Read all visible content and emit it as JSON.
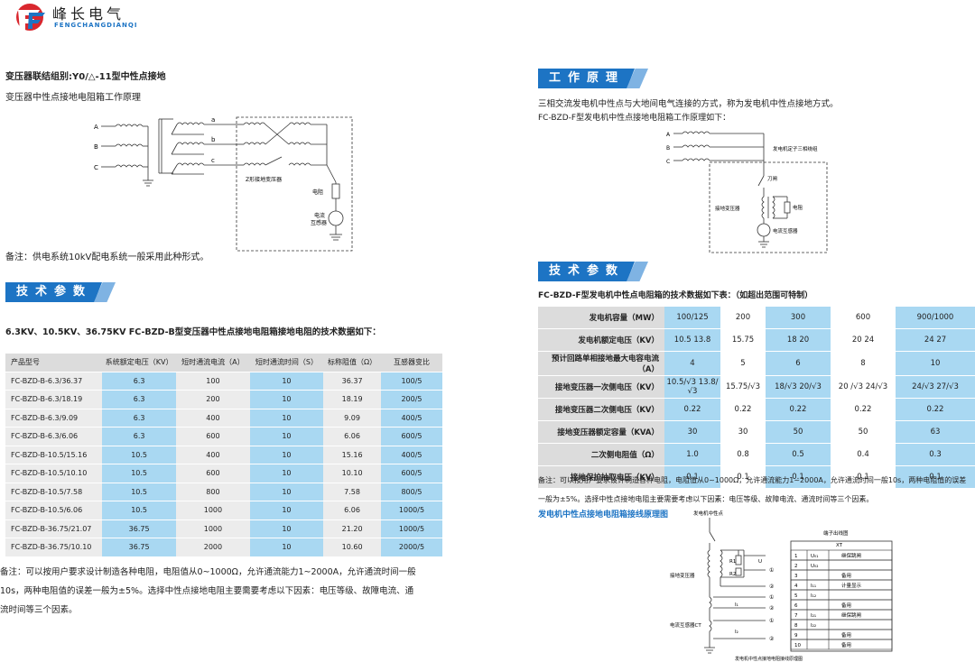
{
  "logo": {
    "name": "峰长电气",
    "sub": "FENGCHANGDIANQI"
  },
  "left": {
    "heading": "变压器联结组别:Y0/△-11型中性点接地",
    "subheading": "变压器中性点接地电阻箱工作原理",
    "diagram": {
      "phases": [
        "A",
        "B",
        "C"
      ],
      "taps": [
        "a",
        "b",
        "c"
      ],
      "z_label": "Z形接地变压器",
      "resistor_label": "电阻",
      "ct_label_1": "电流",
      "ct_label_2": "互感器"
    },
    "note1": "备注：供电系统10kV配电系统一般采用此种形式。",
    "banner": "技术参数",
    "table_title": "6.3KV、10.5KV、36.75KV FC-BZD-B型变压器中性点接地电阻箱接地电阻的技术数据如下：",
    "table": {
      "headers": [
        "产品型号",
        "系统额定电压（KV）",
        "短时通流电流（A）",
        "短时通流时间（S）",
        "标称阻值（Ω）",
        "互感器变比"
      ],
      "rows": [
        [
          "FC-BZD-B-6.3/36.37",
          "6.3",
          "100",
          "10",
          "36.37",
          "100/5"
        ],
        [
          "FC-BZD-B-6.3/18.19",
          "6.3",
          "200",
          "10",
          "18.19",
          "200/5"
        ],
        [
          "FC-BZD-B-6.3/9.09",
          "6.3",
          "400",
          "10",
          "9.09",
          "400/5"
        ],
        [
          "FC-BZD-B-6.3/6.06",
          "6.3",
          "600",
          "10",
          "6.06",
          "600/5"
        ],
        [
          "FC-BZD-B-10.5/15.16",
          "10.5",
          "400",
          "10",
          "15.16",
          "400/5"
        ],
        [
          "FC-BZD-B-10.5/10.10",
          "10.5",
          "600",
          "10",
          "10.10",
          "600/5"
        ],
        [
          "FC-BZD-B-10.5/7.58",
          "10.5",
          "800",
          "10",
          "7.58",
          "800/5"
        ],
        [
          "FC-BZD-B-10.5/6.06",
          "10.5",
          "1000",
          "10",
          "6.06",
          "1000/5"
        ],
        [
          "FC-BZD-B-36.75/21.07",
          "36.75",
          "1000",
          "10",
          "21.20",
          "1000/5"
        ],
        [
          "FC-BZD-B-36.75/10.10",
          "36.75",
          "2000",
          "10",
          "10.60",
          "2000/5"
        ]
      ]
    },
    "note2_lines": [
      "备注：可以按用户要求设计制造各种电阻，电阻值从0~1000Ω，允许通流能力1~2000A，允许通流时间一般",
      "10s，两种电阻值的误差一般为±5%。选择中性点接地电阻主要需要考虑以下因素：电压等级、故障电流、通",
      "流时间等三个因素。"
    ]
  },
  "right": {
    "banner1": "工作原理",
    "intro1": "三相交流发电机中性点与大地间电气连接的方式，称为发电机中性点接地方式。",
    "intro2": "FC-BZD-F型发电机中性点接地电阻箱工作原理如下：",
    "diagram1": {
      "phases": [
        "A",
        "B",
        "C"
      ],
      "stator_label": "发电机定子三相绕组",
      "knife_label": "刀闸",
      "gt_label": "接地变压器",
      "res_label": "电阻",
      "ct_label": "电流互感器"
    },
    "banner2": "技术参数",
    "table_title": "FC-BZD-F型发电机中性点电阻箱的技术数据如下表：（如超出范围可特制）",
    "table": {
      "rows": [
        {
          "h": "发电机容量（MW）",
          "v": [
            "100/125",
            "200",
            "300",
            "600",
            "900/1000"
          ]
        },
        {
          "h": "发电机额定电压（KV）",
          "v": [
            "10.5  13.8",
            "15.75",
            "18   20",
            "20   24",
            "24   27"
          ]
        },
        {
          "h": "预计回路单相接地最大电容电流（A）",
          "v": [
            "4",
            "5",
            "6",
            "8",
            "10"
          ]
        },
        {
          "h": "接地变压器一次侧电压（KV）",
          "v": [
            "10.5/√3  13.8/√3",
            "15.75/√3",
            "18/√3  20/√3",
            "20 /√3  24/√3",
            "24/√3  27/√3"
          ]
        },
        {
          "h": "接地变压器二次侧电压（KV）",
          "v": [
            "0.22",
            "0.22",
            "0.22",
            "0.22",
            "0.22"
          ]
        },
        {
          "h": "接地变压器额定容量（KVA）",
          "v": [
            "30",
            "30",
            "50",
            "50",
            "63"
          ]
        },
        {
          "h": "二次侧电阻值（Ω）",
          "v": [
            "1.0",
            "0.8",
            "0.5",
            "0.4",
            "0.3"
          ]
        },
        {
          "h": "接地保护抽取电压（KV）",
          "v": [
            "0.1",
            "0.1",
            "0.1",
            "0.1",
            "0.1"
          ]
        }
      ]
    },
    "note_lines": [
      "备注：可以按用户要求设计制造各种电阻，电阻值从0~1000Ω，允许通流能力1~2000A，允许通流时间一般10s，两种电阻值的误差",
      "一般为±5%。选择中性点接地电阻主要需要考虑以下因素：电压等级、故障电流、通流时间等三个因素。"
    ],
    "wiring_title": "发电机中性点接地电阻箱接线原理图",
    "wiring": {
      "neutral_label": "发电机中性点",
      "gt_label": "接地变压器",
      "ct_label": "电流互感器CT",
      "r1": "R1",
      "r2": "R2",
      "u": "U",
      "i1": "I₁",
      "i2": "I₂",
      "terminal_title": "端子出线图",
      "xt": "XT",
      "caption": "发电机中性点接地电阻接线原理图",
      "terms": [
        [
          "1",
          "U₀₁",
          "继保跳闸"
        ],
        [
          "2",
          "U₀₂",
          ""
        ],
        [
          "3",
          "",
          "备用"
        ],
        [
          "4",
          "I₁₁",
          "计量显示"
        ],
        [
          "5",
          "I₁₂",
          ""
        ],
        [
          "6",
          "",
          "备用"
        ],
        [
          "7",
          "I₂₁",
          "继保跳闸"
        ],
        [
          "8",
          "I₂₂",
          ""
        ],
        [
          "9",
          "",
          "备用"
        ],
        [
          "10",
          "",
          "备用"
        ]
      ],
      "markers": [
        "①",
        "②",
        "①",
        "②",
        "①",
        "②"
      ]
    }
  },
  "colors": {
    "brand": "#1d74c4",
    "cell_blue": "#a9d8f2",
    "header_grey": "#dcdcdc"
  }
}
